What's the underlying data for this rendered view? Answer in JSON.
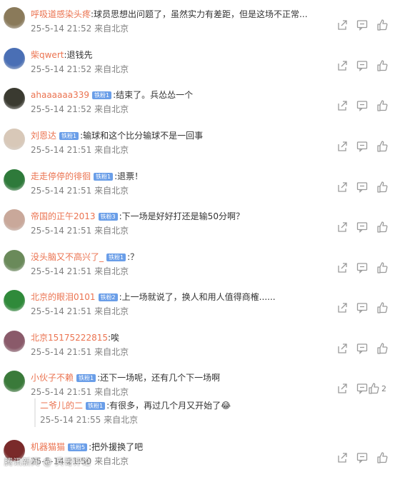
{
  "comments": [
    {
      "user": "呼吸道感染头疼",
      "badge": "",
      "text": ":球员思想出问题了，虽然实力有差距，但是这场不正常...",
      "time": "25-5-14 21:52",
      "location": "来自北京",
      "likes": "",
      "avatar_color": "#8a7a5a"
    },
    {
      "user": "柴qwert",
      "badge": "",
      "text": ":退钱先",
      "time": "25-5-14 21:52",
      "location": "来自北京",
      "likes": "",
      "avatar_color": "#4a6fb5"
    },
    {
      "user": "ahaaaaaa339",
      "badge": "铁粉1",
      "text": ":结束了。兵怂怂一个",
      "time": "25-5-14 21:52",
      "location": "来自北京",
      "likes": "",
      "avatar_color": "#3a3a30"
    },
    {
      "user": "刘恩达",
      "badge": "铁粉1",
      "text": ":输球和这个比分输球不是一回事",
      "time": "25-5-14 21:51",
      "location": "来自北京",
      "likes": "",
      "avatar_color": "#d8c8b8"
    },
    {
      "user": "走走停停的徘徊",
      "badge": "铁粉1",
      "text": ":退票！",
      "time": "25-5-14 21:51",
      "location": "来自北京",
      "likes": "",
      "avatar_color": "#2e7a3a"
    },
    {
      "user": "帝国的正午2013",
      "badge": "铁粉3",
      "text": ":下一场是好好打还是输50分啊？",
      "time": "25-5-14 21:51",
      "location": "来自北京",
      "likes": "",
      "avatar_color": "#c9a89a"
    },
    {
      "user": "没头脑又不高兴了_",
      "badge": "铁粉1",
      "text": ":？",
      "time": "25-5-14 21:51",
      "location": "来自北京",
      "likes": "",
      "avatar_color": "#6a8a5a"
    },
    {
      "user": "北京的眼泪0101",
      "badge": "铁粉2",
      "text": ":上一场就说了，换人和用人值得商榷......",
      "time": "25-5-14 21:51",
      "location": "来自北京",
      "likes": "",
      "avatar_color": "#2f8a3a"
    },
    {
      "user": "北京15175222815",
      "badge": "",
      "text": ":唉",
      "time": "25-5-14 21:51",
      "location": "来自北京",
      "likes": "",
      "avatar_color": "#8a5a6a"
    },
    {
      "user": "小伙子不赖",
      "badge": "铁粉1",
      "text": ":还下一场呢，还有几个下一场啊",
      "time": "25-5-14 21:51",
      "location": "来自北京",
      "likes": "2",
      "avatar_color": "#3a7a3a"
    },
    {
      "user": "机器猫猫",
      "badge": "铁粉5",
      "text": ":把外援换了吧",
      "time": "25-5-14 21:50",
      "location": "来自北京",
      "likes": "",
      "avatar_color": "#7a2a2a"
    }
  ],
  "reply": {
    "user": "二爷儿的二",
    "badge": "铁粉1",
    "text": ":有很多，再过几个月又开始了",
    "emoji": "😂",
    "time": "25-5-14 21:55",
    "location": "来自北京"
  },
  "watermark": "腾讯新闻 @ 兵哥评论"
}
